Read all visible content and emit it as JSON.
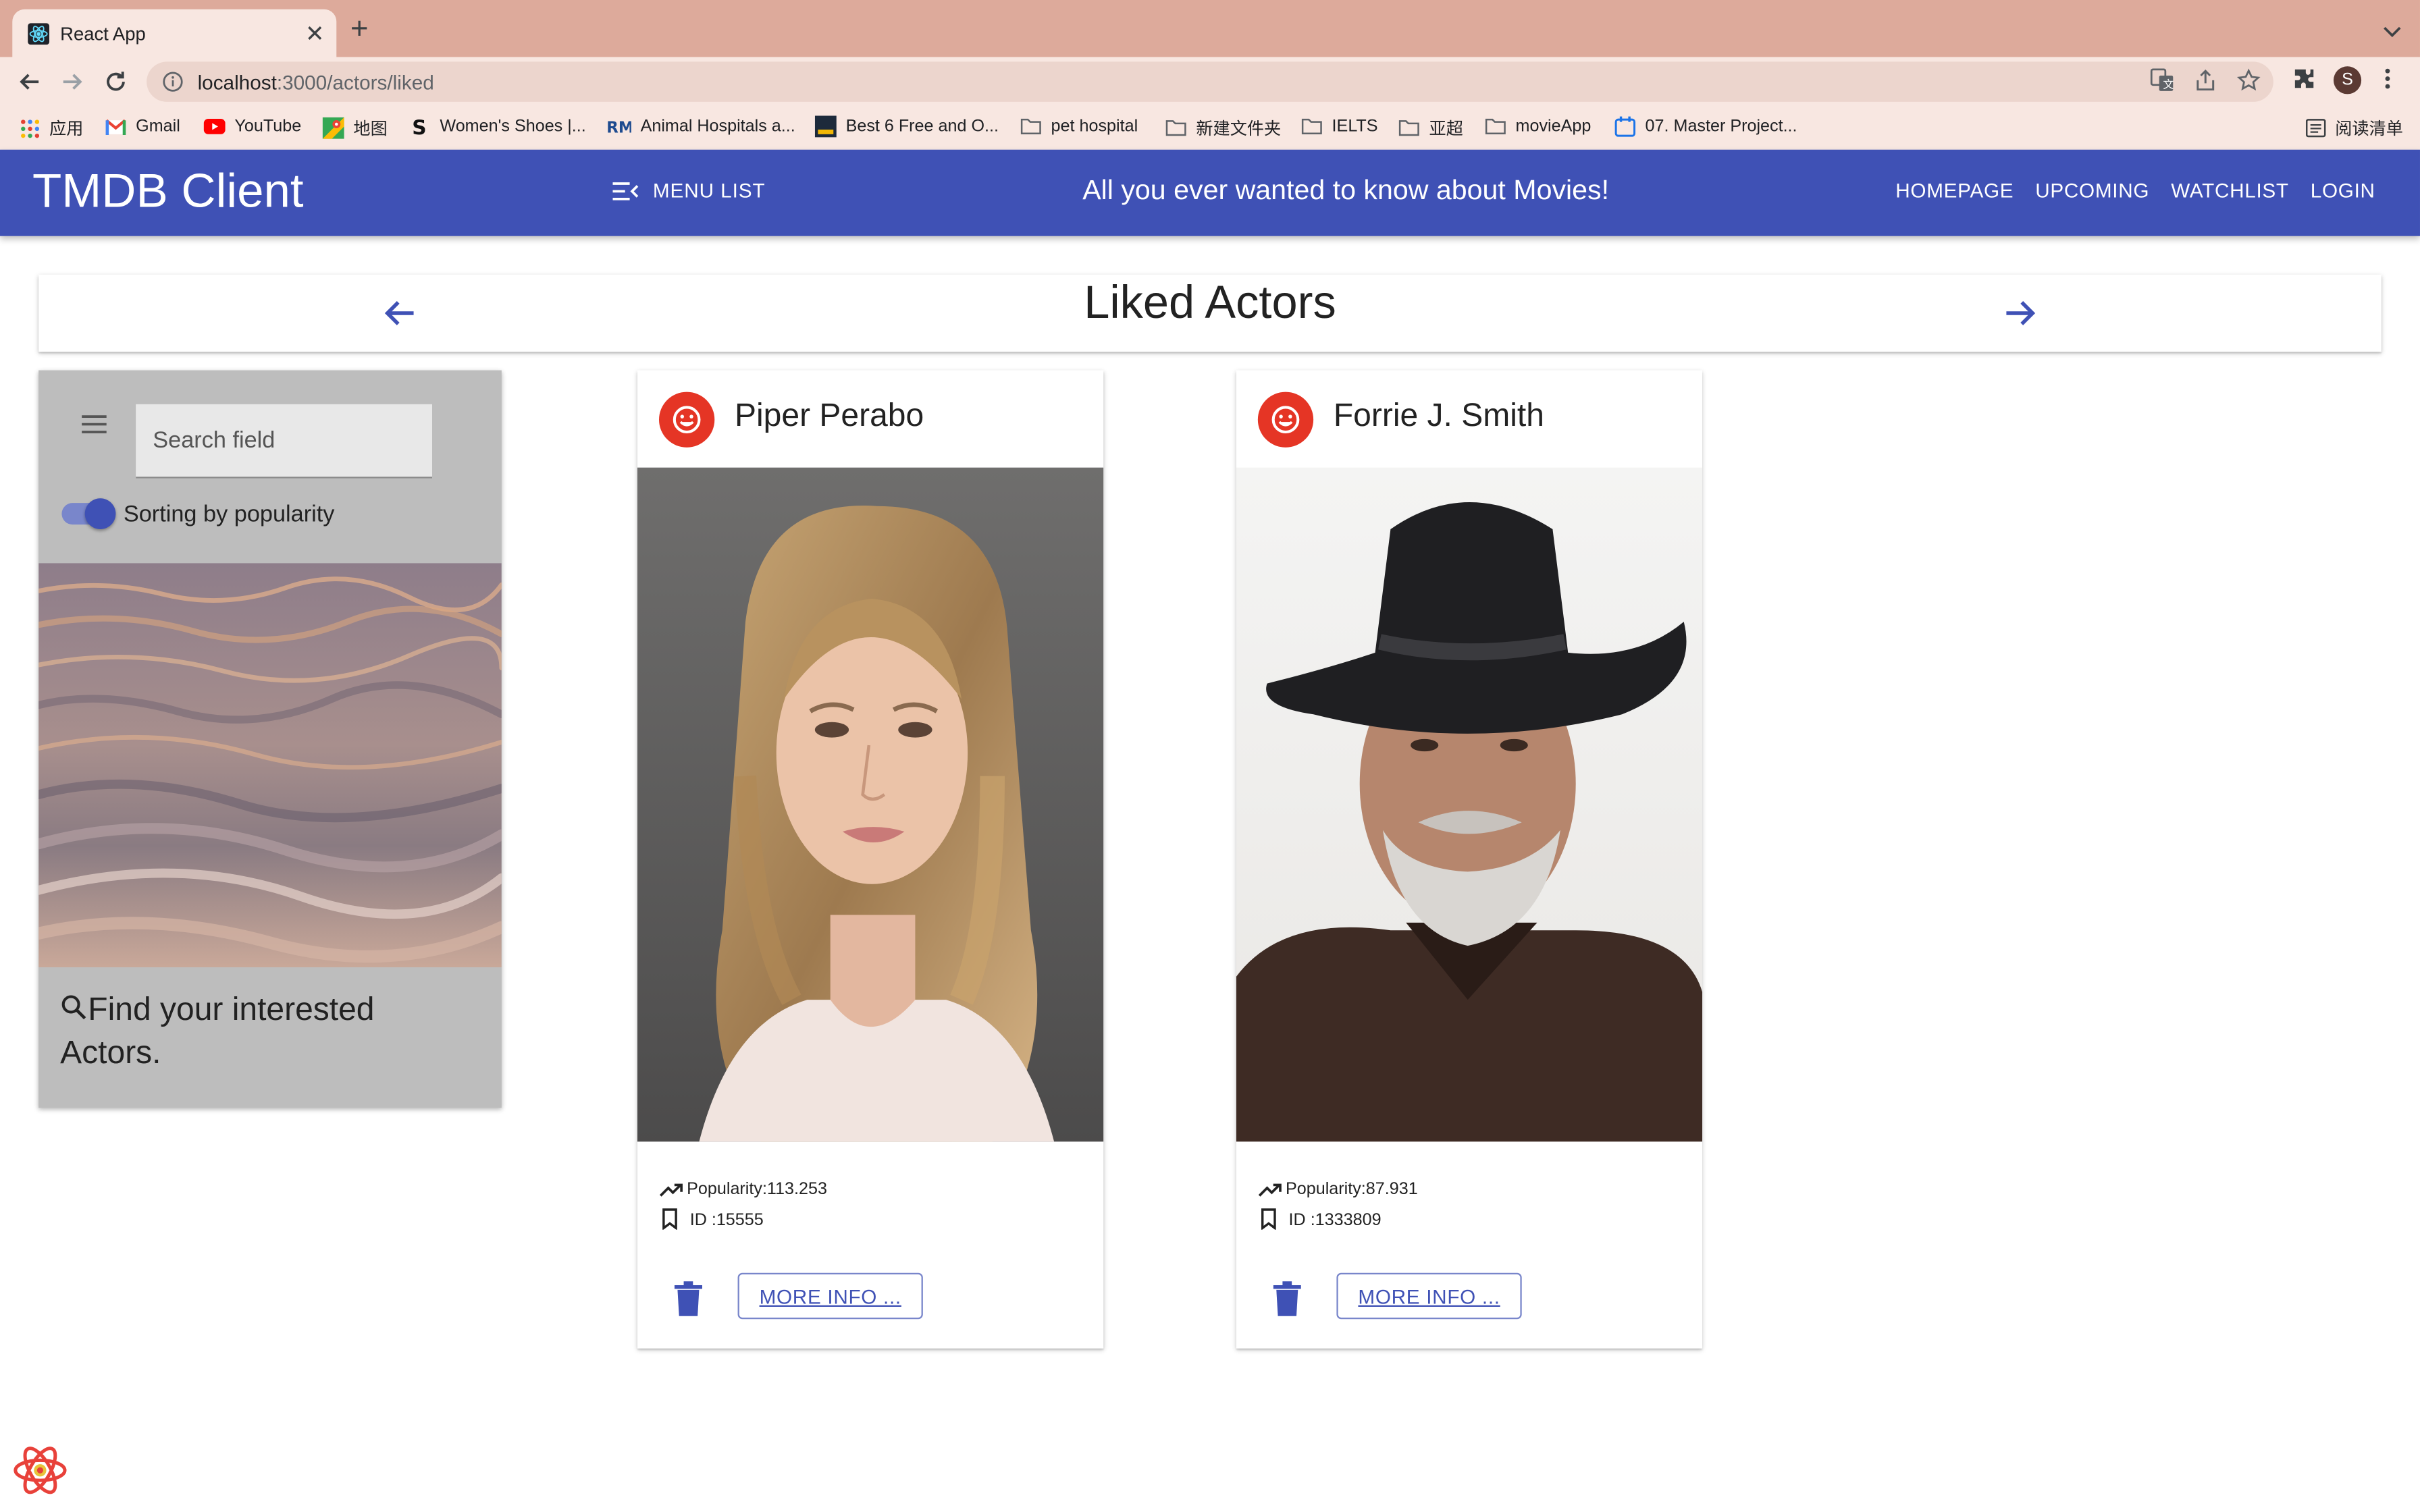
{
  "browser": {
    "tab_title": "React App",
    "url_host": "localhost",
    "url_path": ":3000/actors/liked",
    "profile_initial": "S",
    "bookmarks": [
      {
        "label": "应用",
        "icon": "apps-grid-icon"
      },
      {
        "label": "Gmail",
        "icon": "gmail-icon"
      },
      {
        "label": "YouTube",
        "icon": "youtube-icon"
      },
      {
        "label": "地图",
        "icon": "maps-icon"
      },
      {
        "label": "Women's Shoes |...",
        "icon": "s-logo-icon"
      },
      {
        "label": "Animal Hospitals a...",
        "icon": "rm-logo-icon"
      },
      {
        "label": "Best 6 Free and O...",
        "icon": "site-logo-icon"
      },
      {
        "label": "pet hospital",
        "icon": "folder-icon"
      },
      {
        "label": "新建文件夹",
        "icon": "folder-icon"
      },
      {
        "label": "IELTS",
        "icon": "folder-icon"
      },
      {
        "label": "亚超",
        "icon": "folder-icon"
      },
      {
        "label": "movieApp",
        "icon": "folder-icon"
      },
      {
        "label": "07. Master Project...",
        "icon": "calendar-icon"
      }
    ],
    "reading_list": "阅读清单",
    "colors": {
      "tabstrip": "#ddaa9b",
      "toolbar": "#f8e7e1"
    }
  },
  "app": {
    "title": "TMDB Client",
    "menu_label": "MENU LIST",
    "tagline": "All you ever wanted to know about Movies!",
    "nav": [
      "HOMEPAGE",
      "UPCOMING",
      "WATCHLIST",
      "LOGIN"
    ],
    "colors": {
      "primary": "#3f51b5",
      "liked": "#e53525"
    }
  },
  "page": {
    "heading": "Liked Actors"
  },
  "filter": {
    "search_placeholder": "Search field",
    "toggle_label": "Sorting by popularity",
    "toggle_on": true,
    "caption": "Find your interested Actors."
  },
  "actors": [
    {
      "name": "Piper Perabo",
      "popularity": "Popularity:113.253",
      "id": "ID :15555",
      "more_info": "MORE INFO ..."
    },
    {
      "name": "Forrie J. Smith",
      "popularity": "Popularity:87.931",
      "id": "ID :1333809",
      "more_info": "MORE INFO ..."
    }
  ]
}
